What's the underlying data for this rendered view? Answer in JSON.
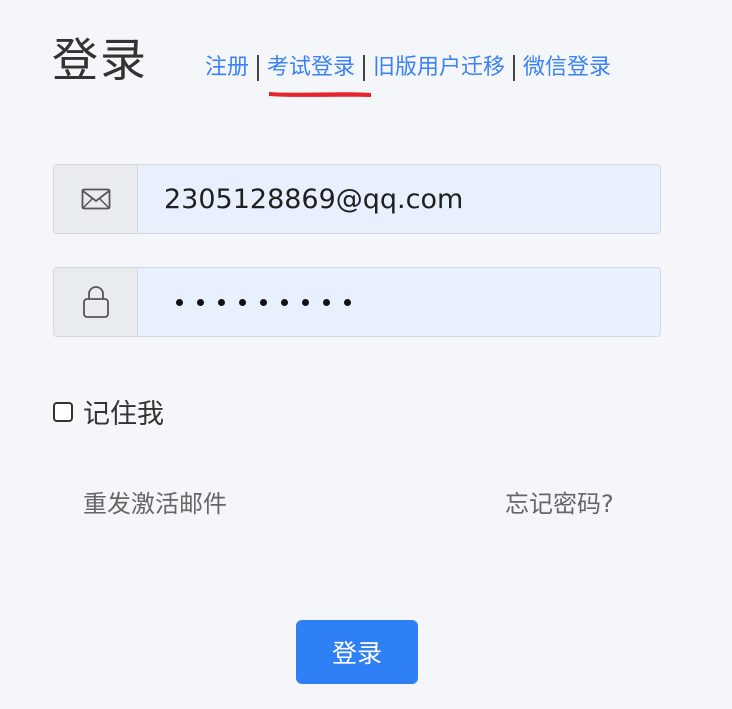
{
  "header": {
    "title": "登录",
    "nav": [
      {
        "label": "注册"
      },
      {
        "label": "考试登录"
      },
      {
        "label": "旧版用户迁移"
      },
      {
        "label": "微信登录"
      }
    ]
  },
  "form": {
    "email": {
      "icon": "mail-icon",
      "value": "2305128869@qq.com"
    },
    "password": {
      "icon": "lock-icon",
      "masked_length": 9
    },
    "remember": {
      "label": "记住我",
      "checked": false
    }
  },
  "links": {
    "resend": "重发激活邮件",
    "forgot": "忘记密码?"
  },
  "submit": {
    "label": "登录"
  },
  "colors": {
    "link": "#3b82f6",
    "button": "#2f7ff5",
    "annotation": "#e6242b",
    "input_bg": "#e8f0fe"
  }
}
